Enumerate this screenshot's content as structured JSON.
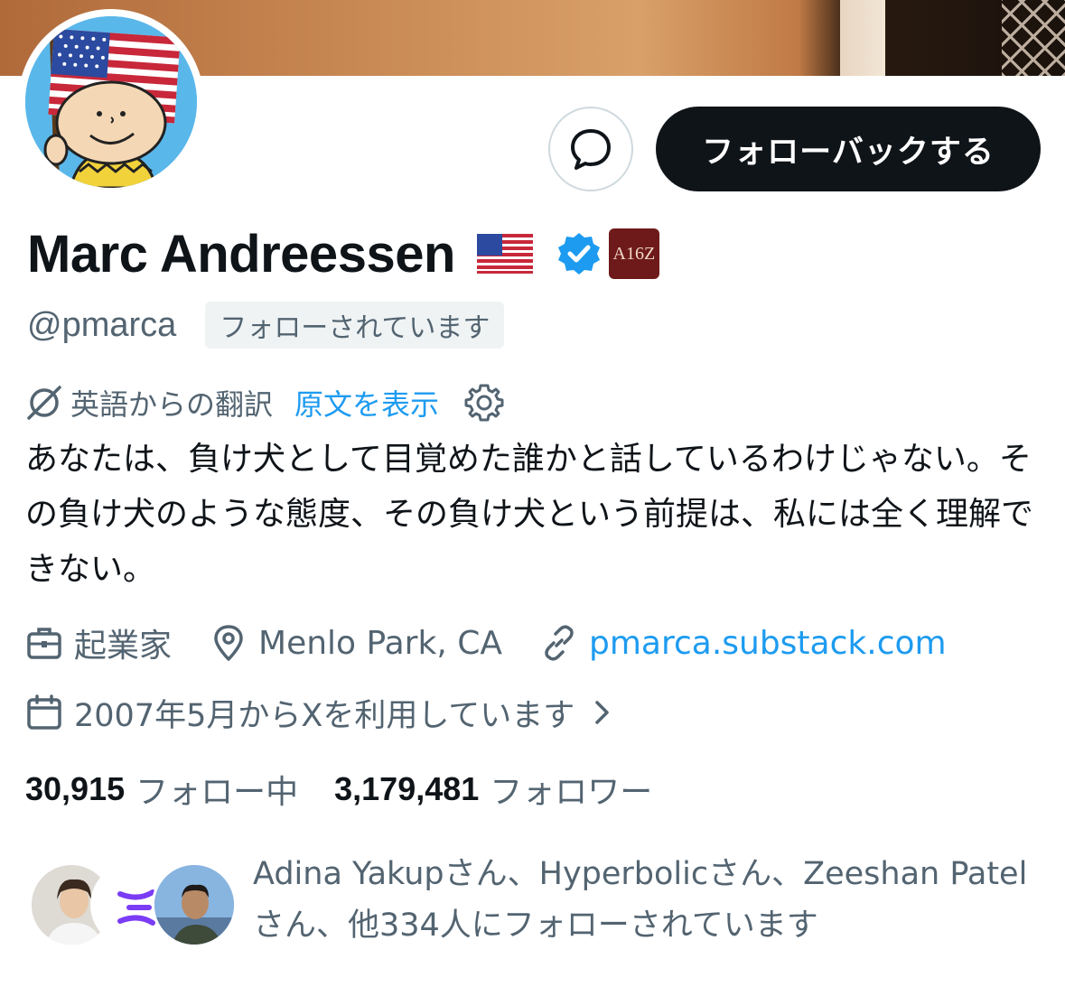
{
  "profile": {
    "name": "Marc Andreessen",
    "handle": "@pmarca",
    "follows_you": "フォローされています",
    "follow_back": "フォローバックする",
    "badge_text": "A16Z"
  },
  "translation": {
    "label": "英語からの翻訳",
    "show_original": "原文を表示"
  },
  "bio": "あなたは、負け犬として目覚めた誰かと話しているわけじゃない。その負け犬のような態度、その負け犬という前提は、私には全く理解できない。",
  "meta": {
    "occupation": "起業家",
    "location": "Menlo Park, CA",
    "website": "pmarca.substack.com",
    "joined": "2007年5月からXを利用しています"
  },
  "stats": {
    "following_count": "30,915",
    "following_label": "フォロー中",
    "followers_count": "3,179,481",
    "followers_label": "フォロワー"
  },
  "followed_by": "Adina Yakupさん、Hyperbolicさん、Zeeshan Patelさん、他334人にフォローされています",
  "colors": {
    "accent": "#1d9bf0",
    "secondary_text": "#536471",
    "primary_text": "#0f1419",
    "button_dark": "#0f1419"
  },
  "icons": [
    "message-icon",
    "flag-icon",
    "verified-badge-icon",
    "affiliate-badge-icon",
    "translate-icon",
    "gear-icon",
    "briefcase-icon",
    "location-pin-icon",
    "link-icon",
    "calendar-icon",
    "chevron-right-icon"
  ]
}
